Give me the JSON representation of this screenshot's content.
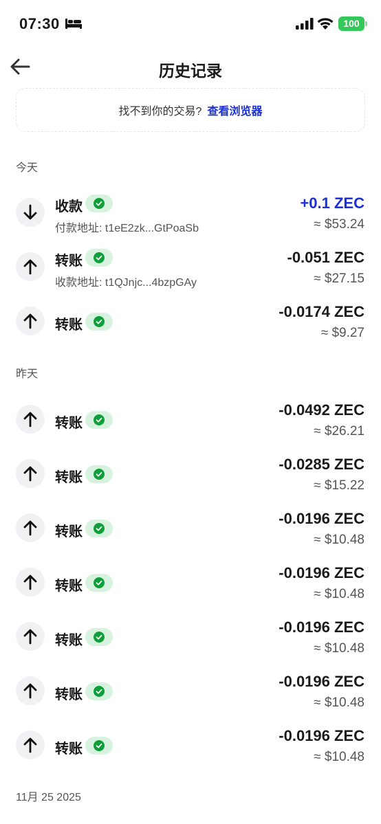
{
  "status_bar": {
    "time": "07:30",
    "battery": "100"
  },
  "header": {
    "title": "历史记录"
  },
  "notice": {
    "text": "找不到你的交易?",
    "link": "查看浏览器"
  },
  "sections": {
    "today": "今天",
    "yesterday": "昨天",
    "older": "11月 25 2025"
  },
  "transactions": [
    {
      "type": "收款",
      "direction": "in",
      "address": "付款地址: t1eE2zk...GtPoaSb",
      "amount": "+0.1 ZEC",
      "fiat": "≈ $53.24"
    },
    {
      "type": "转账",
      "direction": "out",
      "address": "收款地址: t1QJnjc...4bzpGAy",
      "amount": "-0.051 ZEC",
      "fiat": "≈ $27.15"
    },
    {
      "type": "转账",
      "direction": "out",
      "address": "",
      "amount": "-0.0174 ZEC",
      "fiat": "≈ $9.27"
    },
    {
      "type": "转账",
      "direction": "out",
      "address": "",
      "amount": "-0.0492 ZEC",
      "fiat": "≈ $26.21"
    },
    {
      "type": "转账",
      "direction": "out",
      "address": "",
      "amount": "-0.0285 ZEC",
      "fiat": "≈ $15.22"
    },
    {
      "type": "转账",
      "direction": "out",
      "address": "",
      "amount": "-0.0196 ZEC",
      "fiat": "≈ $10.48"
    },
    {
      "type": "转账",
      "direction": "out",
      "address": "",
      "amount": "-0.0196 ZEC",
      "fiat": "≈ $10.48"
    },
    {
      "type": "转账",
      "direction": "out",
      "address": "",
      "amount": "-0.0196 ZEC",
      "fiat": "≈ $10.48"
    },
    {
      "type": "转账",
      "direction": "out",
      "address": "",
      "amount": "-0.0196 ZEC",
      "fiat": "≈ $10.48"
    },
    {
      "type": "转账",
      "direction": "out",
      "address": "",
      "amount": "-0.0196 ZEC",
      "fiat": "≈ $10.48"
    }
  ],
  "colors": {
    "accent": "#1a2fd6",
    "success": "#0e9f3a",
    "success_bg": "#d7f3df"
  }
}
